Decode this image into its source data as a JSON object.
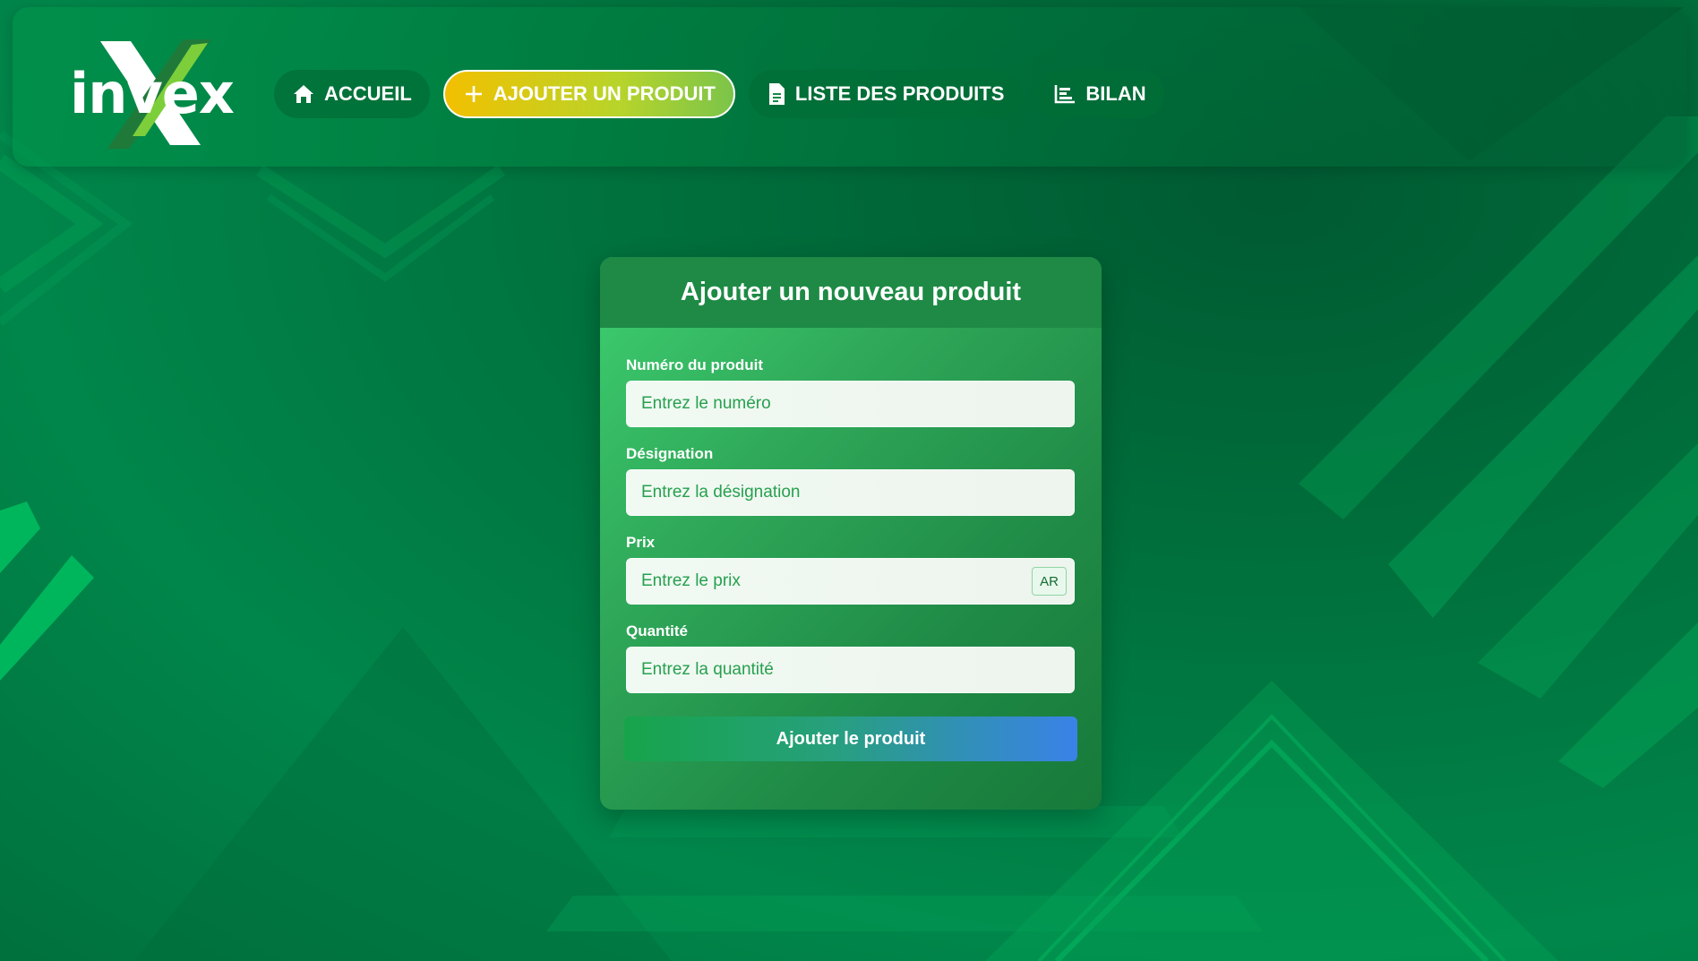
{
  "brand": {
    "name": "invex"
  },
  "nav": {
    "items": [
      {
        "label": "ACCUEIL",
        "icon": "home-icon"
      },
      {
        "label": "AJOUTER UN PRODUIT",
        "icon": "plus-icon",
        "active": true
      },
      {
        "label": "LISTE DES PRODUITS",
        "icon": "document-icon"
      },
      {
        "label": "BILAN",
        "icon": "chart-icon"
      }
    ]
  },
  "form": {
    "title": "Ajouter un nouveau produit",
    "fields": [
      {
        "label": "Numéro du produit",
        "placeholder": "Entrez le numéro",
        "value": ""
      },
      {
        "label": "Désignation",
        "placeholder": "Entrez la désignation",
        "value": ""
      },
      {
        "label": "Prix",
        "placeholder": "Entrez le prix",
        "value": "",
        "suffix": "AR"
      },
      {
        "label": "Quantité",
        "placeholder": "Entrez la quantité",
        "value": ""
      }
    ],
    "submit_label": "Ajouter le produit"
  },
  "colors": {
    "primary_green": "#00864a",
    "active_nav_start": "#f2c000",
    "active_nav_end": "#7bc44a",
    "submit_start": "#16a44a",
    "submit_end": "#3a82e8"
  }
}
